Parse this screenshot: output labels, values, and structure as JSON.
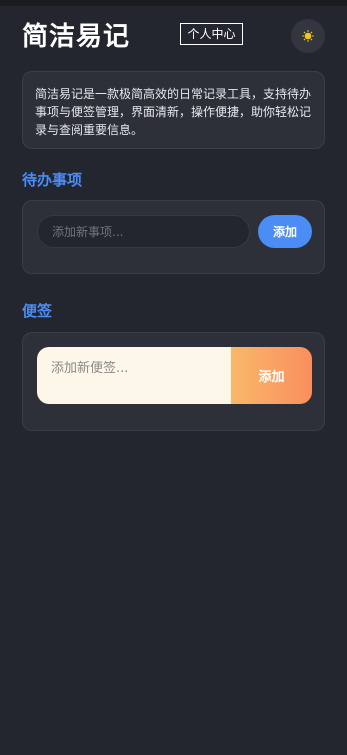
{
  "app": {
    "title": "简洁易记"
  },
  "header": {
    "profile_label": "个人中心",
    "theme_icon": "sun-icon",
    "theme_icon_color": "#f5c518"
  },
  "intro": {
    "text": "简洁易记是一款极简高效的日常记录工具，支持待办事项与便签管理，界面清新，操作便捷，助你轻松记录与查阅重要信息。"
  },
  "todo": {
    "section_title": "待办事项",
    "input_placeholder": "添加新事项...",
    "input_value": "",
    "add_label": "添加"
  },
  "notes": {
    "section_title": "便签",
    "input_placeholder": "添加新便签...",
    "input_value": "",
    "add_label": "添加"
  },
  "colors": {
    "background": "#23262e",
    "card": "#2d3038",
    "accent_blue": "#4b8cf5",
    "note_paper": "#fdf7e9",
    "note_button_from": "#f9b86a",
    "note_button_to": "#fa8e5e"
  }
}
